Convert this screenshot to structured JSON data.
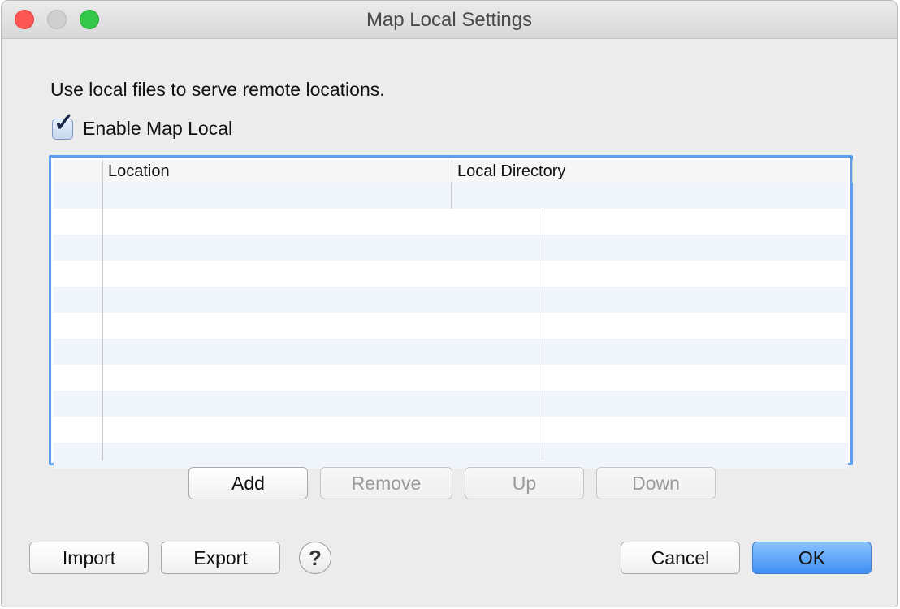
{
  "window": {
    "title": "Map Local Settings"
  },
  "dialog": {
    "description": "Use local files to serve remote locations.",
    "enable_checkbox": {
      "label": "Enable Map Local",
      "checked": true
    }
  },
  "table": {
    "columns": [
      "Location",
      "Local Directory"
    ],
    "rows": []
  },
  "row_buttons": {
    "add": "Add",
    "remove": "Remove",
    "up": "Up",
    "down": "Down"
  },
  "footer": {
    "import": "Import",
    "export": "Export",
    "help": "?",
    "cancel": "Cancel",
    "ok": "OK"
  },
  "icons": {
    "checkmark": "checkmark-icon",
    "help": "question-mark-icon"
  },
  "colors": {
    "focus_ring": "#5aa0f0",
    "primary_button": "#3d8ff3",
    "close": "#fc5753",
    "zoom": "#34c84a"
  }
}
